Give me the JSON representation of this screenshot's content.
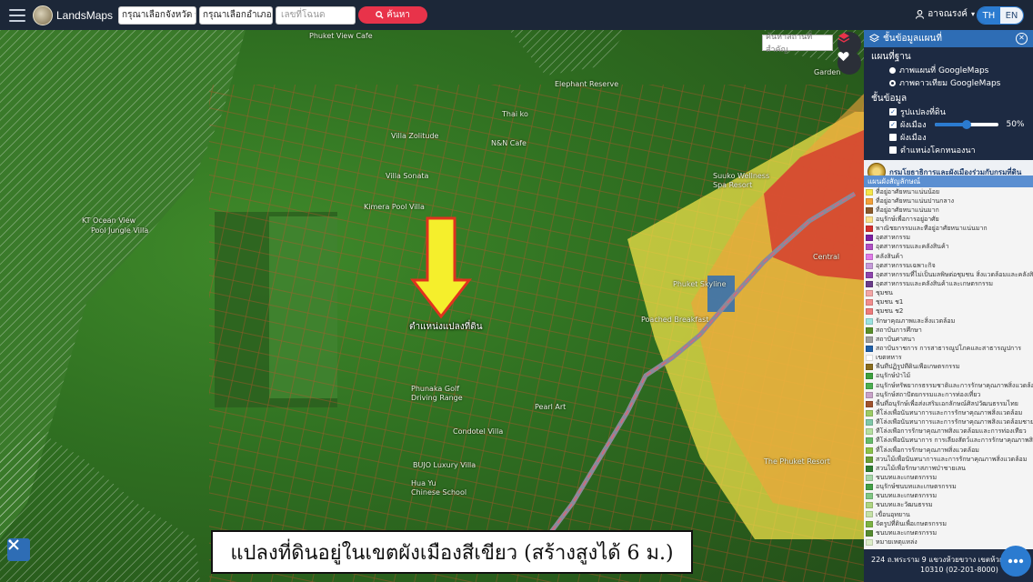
{
  "header": {
    "brand": "LandsMaps",
    "province_select": "กรุณาเลือกจังหวัด",
    "district_select": "กรุณาเลือกอำเภอ",
    "parcel_placeholder": "เลขที่โฉนด",
    "search_label": "ค้นหา",
    "user_name": "อาจณรงค์",
    "lang_th": "TH",
    "lang_en": "EN",
    "active_lang": "TH"
  },
  "map": {
    "place_search_placeholder": "ค้นหาสถานที่สำคัญ",
    "marker_label": "ตำแหน่งแปลงที่ดิน",
    "caption": "แปลงที่ดินอยู่ในเขตผังเมืองสีเขียว (สร้างสูงได้ 6 ม.)",
    "place_labels": [
      "Phuket View Cafe",
      "Elephant Reserve",
      "Thai ko",
      "Villa Zolitude",
      "N&N Cafe",
      "Villa Sonata",
      "Kimera Pool Villa",
      "Suuko Wellness",
      "Spa Resort",
      "KT Ocean View",
      "Pool Jungle Villa",
      "Phuket Skyline",
      "Poached Breakfast",
      "Pearl Art",
      "Phunaka Golf",
      "Driving Range",
      "Condotel Villa",
      "BUJO Luxury Villa",
      "Hua Yu",
      "Chinese School",
      "The Phuket Resort",
      "Garden",
      "Central"
    ]
  },
  "panel": {
    "title": "ชั้นข้อมูลแผนที่",
    "basemap_heading": "แผนที่ฐาน",
    "basemap_options": [
      "ภาพแผนที่ GoogleMaps",
      "ภาพดาวเทียม GoogleMaps"
    ],
    "basemap_selected_index": 1,
    "layers_heading": "ชั้นข้อมูล",
    "layers": [
      {
        "label": "รูปแปลงที่ดิน",
        "checked": true
      },
      {
        "label": "ผังเมือง",
        "checked": true
      },
      {
        "label": "ผังเมือง",
        "checked": false
      },
      {
        "label": "ตำแหน่งโคกหนองนา",
        "checked": false
      }
    ],
    "opacity_percent": 50,
    "opacity_label": "50%",
    "department": "กรมโยธาธิการและผังเมืองร่วมกับกรมที่ดิน",
    "legend_title": "แผนผังสัญลักษณ์",
    "legend_items": [
      {
        "label": "ที่อยู่อาศัยหนาแน่นน้อย",
        "color": "#f6e64a"
      },
      {
        "label": "ที่อยู่อาศัยหนาแน่นปานกลาง",
        "color": "#f3a13a"
      },
      {
        "label": "ที่อยู่อาศัยหนาแน่นมาก",
        "color": "#8b5a2b"
      },
      {
        "label": "อนุรักษ์เพื่อการอยู่อาศัย",
        "color": "#f9e08a"
      },
      {
        "label": "พาณิชยกรรมและที่อยู่อาศัยหนาแน่นมาก",
        "color": "#d32f2f"
      },
      {
        "label": "อุตสาหกรรม",
        "color": "#7b1fa2"
      },
      {
        "label": "อุตสาหกรรมและคลังสินค้า",
        "color": "#b04fc4"
      },
      {
        "label": "คลังสินค้า",
        "color": "#e07be8"
      },
      {
        "label": "อุตสาหกรรมเฉพาะกิจ",
        "color": "#c59ad9"
      },
      {
        "label": "อุตสาหกรรมที่ไม่เป็นมลพิษต่อชุมชน สิ่งแวดล้อมและคลังสินค้า",
        "color": "#8e44ad"
      },
      {
        "label": "อุตสาหกรรมและคลังสินค้าและเกษตรกรรม",
        "color": "#6a3b8a"
      },
      {
        "label": "ชุมชน",
        "color": "#f4a6a6"
      },
      {
        "label": "ชุมชน ช1",
        "color": "#f28d8d"
      },
      {
        "label": "ชุมชน ช2",
        "color": "#ee7a7a"
      },
      {
        "label": "รักษาคุณภาพและสิ่งแวดล้อม",
        "color": "#9be3e0"
      },
      {
        "label": "สถาบันการศึกษา",
        "color": "#5a8f2a"
      },
      {
        "label": "สถาบันศาสนา",
        "color": "#9e9e9e"
      },
      {
        "label": "สถาบันราชการ การสาธารณูปโภคและสาธารณูปการ",
        "color": "#1e5fa8"
      },
      {
        "label": "เขตทหาร",
        "color": "#ffffff"
      },
      {
        "label": "พื้นที่ปฏิรูปที่ดินเพื่อเกษตรกรรม",
        "color": "#8a6d1e"
      },
      {
        "label": "อนุรักษ์ป่าไม้",
        "color": "#3da03d"
      },
      {
        "label": "อนุรักษ์ทรัพยากรธรรมชาติและการรักษาคุณภาพสิ่งแวดล้อม",
        "color": "#4caf50"
      },
      {
        "label": "อนุรักษ์สถาปัตยกรรมและการท่องเที่ยว",
        "color": "#c8a2c8"
      },
      {
        "label": "พื้นที่อนุรักษ์เพื่อส่งเสริมเอกลักษณ์ศิลปวัฒนธรรมไทย",
        "color": "#a0522d"
      },
      {
        "label": "ที่โล่งเพื่อนันทนาการและการรักษาคุณภาพสิ่งแวดล้อม",
        "color": "#9ccc65"
      },
      {
        "label": "ที่โล่งเพื่อนันทนาการและการรักษาคุณภาพสิ่งแวดล้อมชายฝั่ง",
        "color": "#7fc8a9"
      },
      {
        "label": "ที่โล่งเพื่อการรักษาคุณภาพสิ่งแวดล้อมและการท่องเที่ยว",
        "color": "#b5e0a0"
      },
      {
        "label": "ที่โล่งเพื่อนันทนาการ การเลี้ยงสัตว์และการรักษาคุณภาพสิ่งแวดล้อม",
        "color": "#66bb6a"
      },
      {
        "label": "ที่โล่งเพื่อการรักษาคุณภาพสิ่งแวดล้อม",
        "color": "#8bc34a"
      },
      {
        "label": "สวนไม้เพื่อนันทนาการและการรักษาคุณภาพสิ่งแวดล้อม",
        "color": "#689f38"
      },
      {
        "label": "สวนไม้เพื่อรักษาสภาพป่าชายเลน",
        "color": "#2e7d32"
      },
      {
        "label": "ชนบทและเกษตรกรรม",
        "color": "#a5d6a7"
      },
      {
        "label": "อนุรักษ์ชนบทและเกษตรกรรม",
        "color": "#43a047"
      },
      {
        "label": "ชนบทและเกษตรกรรม",
        "color": "#81c784"
      },
      {
        "label": "ชนบทและวัฒนธรรม",
        "color": "#aed581"
      },
      {
        "label": "เขื่อนอุทยาน",
        "color": "#c5e1a5"
      },
      {
        "label": "จัดรูปที่ดินเพื่อเกษตรกรรม",
        "color": "#7cb342"
      },
      {
        "label": "ชนบทและเกษตรกรรม",
        "color": "#558b2f"
      },
      {
        "label": "หมายเหตุแหล่ง",
        "color": "#dcedc8"
      }
    ],
    "address_line1": "224 ถ.พระราม 9 แขวงห้วยขวาง เขตห้วยขวาง",
    "address_line2": "10310 (02-201-8000)"
  },
  "colors": {
    "topbar": "#1c2738",
    "search_button": "#e8334a",
    "accent_blue": "#2e6db5",
    "green_zone": "#3f8a2a",
    "yellow_zone": "#f6e64a",
    "orange_zone": "#f3a13a",
    "red_zone": "#d32f2f"
  },
  "icons": {
    "menu": "hamburger-icon",
    "search": "search-icon",
    "user": "user-icon",
    "layers": "layers-icon",
    "favorite": "heart-icon",
    "close": "close-icon",
    "tools": "tools-icon",
    "chat": "chat-icon",
    "arrow": "down-arrow-marker"
  }
}
